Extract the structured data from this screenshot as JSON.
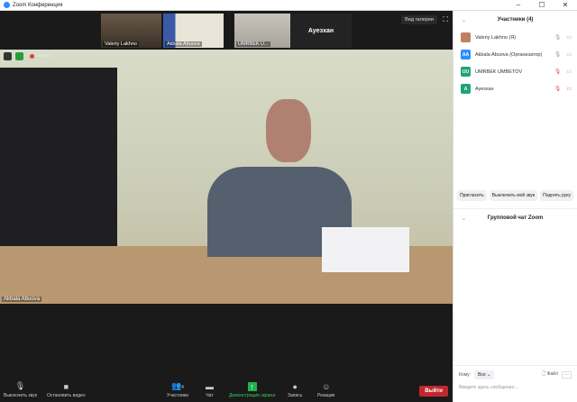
{
  "window": {
    "title": "Zoom Конференция",
    "minimize": "–",
    "maximize": "☐",
    "close": "✕"
  },
  "strip": {
    "thumbs": [
      "Valeriy Lakhno",
      "Akbala Abuova",
      "UMRBEK U...",
      "Ауезхан"
    ],
    "gallery_label": "Вид галереи",
    "fullscreen": "⛶"
  },
  "video": {
    "recording": "Запись",
    "speaker": "Akbala Abuova"
  },
  "toolbar": {
    "mute": "Выключить звук",
    "video": "Остановить видео",
    "participants": "Участники",
    "participants_count": "4",
    "chat": "Чат",
    "share": "Демонстрация экрана",
    "record": "Запись",
    "reactions": "Реакции",
    "leave": "Выйти"
  },
  "panel": {
    "title": "Участники (4)",
    "participants": [
      {
        "name": "Valeriy Lakhno (Я)",
        "initials": "",
        "color": "#c08060"
      },
      {
        "name": "Akbala Abuova (Организатор)",
        "initials": "AA",
        "color": "#2d8cff"
      },
      {
        "name": "UMRBEK UMBETOV",
        "initials": "UU",
        "color": "#1fa37a"
      },
      {
        "name": "Ауезхан",
        "initials": "A",
        "color": "#1fa37a"
      }
    ],
    "invite": "Пригласить",
    "mute_me": "Выключить мой звук",
    "raise_hand": "Поднять руку",
    "chat_title": "Групповой чат Zoom",
    "to_label": "Кому:",
    "to_value": "Все",
    "file": "Файл",
    "more": "···",
    "placeholder": "Введите здесь сообщение..."
  }
}
